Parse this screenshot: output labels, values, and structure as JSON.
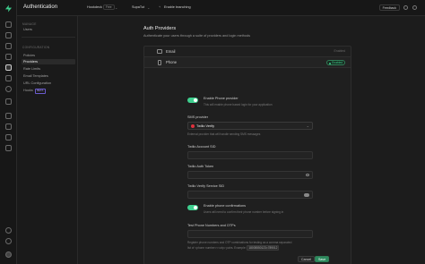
{
  "app": {
    "title": "Authentication",
    "accent": "#3ecf8e"
  },
  "topbar": {
    "org": "Hookdeck",
    "org_plan": "Free",
    "project": "SupaTut",
    "branching": "Enable branching",
    "feedback": "Feedback"
  },
  "sidebar": {
    "manage_header": "MANAGE",
    "manage_items": [
      {
        "label": "Users"
      }
    ],
    "config_header": "CONFIGURATION",
    "config_items": [
      {
        "label": "Policies"
      },
      {
        "label": "Providers",
        "active": true
      },
      {
        "label": "Rate Limits"
      },
      {
        "label": "Email Templates"
      },
      {
        "label": "URL Configuration"
      },
      {
        "label": "Hooks",
        "badge": "BETA"
      }
    ]
  },
  "page": {
    "title": "Auth Providers",
    "subtitle": "Authenticate your users through a suite of providers and login methods"
  },
  "providers": [
    {
      "name": "Email",
      "status": "Enabled",
      "icon": "mail-icon"
    },
    {
      "name": "Phone",
      "status": "Enabled",
      "icon": "phone-icon",
      "expanded": true
    }
  ],
  "phone_form": {
    "enable_label": "Enable Phone provider",
    "enable_help": "This will enable phone based login for your application",
    "sms_label": "SMS provider",
    "sms_value": "Twilio Verify",
    "sms_help": "External provider that will handle sending SMS messages",
    "account_sid_label": "Twilio Account SID",
    "account_sid_value": "",
    "auth_token_label": "Twilio Auth Token",
    "auth_token_value": "",
    "verify_sid_label": "Twilio Verify Service SID",
    "verify_sid_value": "",
    "confirm_label": "Enable phone confirmations",
    "confirm_help": "Users will need to confirm their phone number before signing in",
    "test_label": "Test Phone Numbers and OTPs",
    "test_value": "",
    "test_help_1": "Register phone numbers and OTP combinations for testing as a comma separated",
    "test_help_2": "list of <phone number>=<otp> pairs. Example:",
    "test_example": "18005550123=789012",
    "cancel_label": "Cancel",
    "save_label": "Save"
  }
}
